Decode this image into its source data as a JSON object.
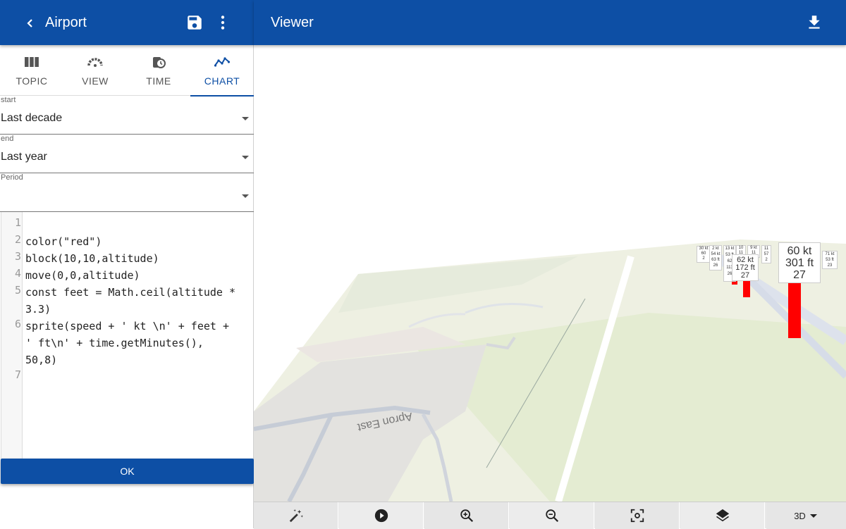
{
  "left_header": {
    "title": "Airport"
  },
  "tabs": [
    {
      "label": "TOPIC",
      "icon": "columns-icon"
    },
    {
      "label": "VIEW",
      "icon": "gauge-icon"
    },
    {
      "label": "TIME",
      "icon": "history-icon"
    },
    {
      "label": "CHART",
      "icon": "chart-line-icon"
    }
  ],
  "active_tab": "CHART",
  "fields": {
    "start": {
      "label": "start",
      "value": "Last decade"
    },
    "end": {
      "label": "end",
      "value": "Last year"
    },
    "period": {
      "label": "Period",
      "value": ""
    }
  },
  "editor": {
    "line_numbers": [
      "1",
      "2",
      "3",
      "4",
      "5",
      "",
      "6",
      "",
      "",
      "7"
    ],
    "lines": [
      "",
      "color(\"red\")",
      "block(10,10,altitude)",
      "move(0,0,altitude)",
      "const feet = Math.ceil(altitude *",
      "3.3)",
      "sprite(speed + ' kt \\n' + feet +",
      "' ft\\n' + time.getMinutes(),",
      "50,8)",
      ""
    ]
  },
  "ok_label": "OK",
  "right_header": {
    "title": "Viewer"
  },
  "map": {
    "apron_label": "Apron East",
    "main_sprite": {
      "speed": "60 kt",
      "feet": "301 ft",
      "minutes": "27"
    },
    "sprite2": {
      "speed": "62 kt",
      "feet": "172 ft",
      "minutes": "27"
    },
    "small_sprites": [
      {
        "lines": [
          "30 kt",
          "60",
          "2"
        ]
      },
      {
        "lines": [
          "2 kt",
          "54 kt",
          "63 ft",
          "26"
        ]
      },
      {
        "lines": [
          "13 kt",
          "53 ft",
          "62",
          "113",
          "26"
        ]
      },
      {
        "lines": [
          "10",
          "11"
        ]
      },
      {
        "lines": [
          "9 kt",
          "11"
        ]
      },
      {
        "lines": [
          "11",
          "57",
          "2"
        ]
      },
      {
        "lines": [
          "71 kt",
          "53 ft",
          "23"
        ]
      }
    ]
  },
  "toolbar": {
    "mode": "3D"
  },
  "colors": {
    "primary": "#0d4fa5",
    "sprite_block": "#ff0000",
    "ground": "#e8ecd6"
  }
}
